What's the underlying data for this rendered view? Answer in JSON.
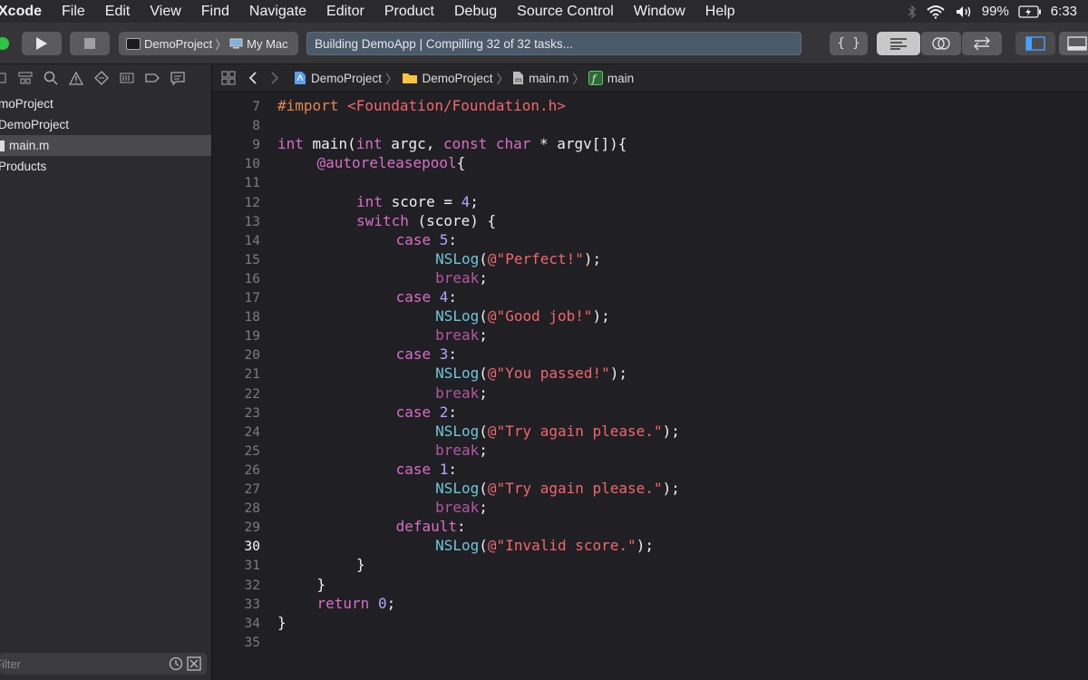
{
  "menubar": {
    "app": "Xcode",
    "items": [
      "File",
      "Edit",
      "View",
      "Find",
      "Navigate",
      "Editor",
      "Product",
      "Debug",
      "Source Control",
      "Window",
      "Help"
    ],
    "battery": "99%",
    "time": "6:33"
  },
  "toolbar": {
    "scheme": "DemoProject",
    "destination": "My Mac",
    "activity": "Building DemoApp | Compilling 32 of 32 tasks..."
  },
  "navigator": {
    "items": [
      {
        "label": "moProject",
        "indent": 0
      },
      {
        "label": "DemoProject",
        "indent": 0
      },
      {
        "label": "main.m",
        "indent": 1
      },
      {
        "label": "Products",
        "indent": 0
      }
    ],
    "filter_placeholder": "Filter"
  },
  "jumpbar": {
    "crumbs": [
      "DemoProject",
      "DemoProject",
      "main.m",
      "main"
    ]
  },
  "editor": {
    "current_line": 30,
    "lines": [
      {
        "n": "7",
        "indent": 0,
        "tokens": [
          [
            "pre",
            "#import "
          ],
          [
            "str",
            "<Foundation/Foundation.h>"
          ]
        ]
      },
      {
        "n": "8",
        "indent": 0,
        "tokens": []
      },
      {
        "n": "9",
        "indent": 0,
        "tokens": [
          [
            "kw",
            "int"
          ],
          [
            "pl",
            " main("
          ],
          [
            "kw",
            "int"
          ],
          [
            "pl",
            " argc, "
          ],
          [
            "kw",
            "const char"
          ],
          [
            "pl",
            " * argv[]){"
          ]
        ]
      },
      {
        "n": "10",
        "indent": 4,
        "tokens": [
          [
            "kw",
            "@autoreleasepool"
          ],
          [
            "pl",
            "{"
          ]
        ]
      },
      {
        "n": "11",
        "indent": 0,
        "tokens": []
      },
      {
        "n": "12",
        "indent": 8,
        "tokens": [
          [
            "kw",
            "int"
          ],
          [
            "pl",
            " score = "
          ],
          [
            "num",
            "4"
          ],
          [
            "pl",
            ";"
          ]
        ]
      },
      {
        "n": "13",
        "indent": 8,
        "tokens": [
          [
            "kw",
            "switch"
          ],
          [
            "pl",
            " (score) {"
          ]
        ]
      },
      {
        "n": "14",
        "indent": 12,
        "tokens": [
          [
            "kw",
            "case "
          ],
          [
            "num",
            "5"
          ],
          [
            "pl",
            ":"
          ]
        ]
      },
      {
        "n": "15",
        "indent": 16,
        "tokens": [
          [
            "fn",
            "NSLog"
          ],
          [
            "pl",
            "("
          ],
          [
            "str",
            "@\"Perfect!\""
          ],
          [
            "pl",
            ");"
          ]
        ]
      },
      {
        "n": "16",
        "indent": 16,
        "tokens": [
          [
            "brk",
            "break"
          ],
          [
            "pl",
            ";"
          ]
        ]
      },
      {
        "n": "17",
        "indent": 12,
        "tokens": [
          [
            "kw",
            "case "
          ],
          [
            "num",
            "4"
          ],
          [
            "pl",
            ":"
          ]
        ]
      },
      {
        "n": "18",
        "indent": 16,
        "tokens": [
          [
            "fn",
            "NSLog"
          ],
          [
            "pl",
            "("
          ],
          [
            "str",
            "@\"Good job!\""
          ],
          [
            "pl",
            ");"
          ]
        ]
      },
      {
        "n": "19",
        "indent": 16,
        "tokens": [
          [
            "brk",
            "break"
          ],
          [
            "pl",
            ";"
          ]
        ]
      },
      {
        "n": "20",
        "indent": 12,
        "tokens": [
          [
            "kw",
            "case "
          ],
          [
            "num",
            "3"
          ],
          [
            "pl",
            ":"
          ]
        ]
      },
      {
        "n": "21",
        "indent": 16,
        "tokens": [
          [
            "fn",
            "NSLog"
          ],
          [
            "pl",
            "("
          ],
          [
            "str",
            "@\"You passed!\""
          ],
          [
            "pl",
            ");"
          ]
        ]
      },
      {
        "n": "22",
        "indent": 16,
        "tokens": [
          [
            "brk",
            "break"
          ],
          [
            "pl",
            ";"
          ]
        ]
      },
      {
        "n": "23",
        "indent": 12,
        "tokens": [
          [
            "kw",
            "case "
          ],
          [
            "num",
            "2"
          ],
          [
            "pl",
            ":"
          ]
        ]
      },
      {
        "n": "24",
        "indent": 16,
        "tokens": [
          [
            "fn",
            "NSLog"
          ],
          [
            "pl",
            "("
          ],
          [
            "str",
            "@\"Try again please.\""
          ],
          [
            "pl",
            ");"
          ]
        ]
      },
      {
        "n": "25",
        "indent": 16,
        "tokens": [
          [
            "brk",
            "break"
          ],
          [
            "pl",
            ";"
          ]
        ]
      },
      {
        "n": "26",
        "indent": 12,
        "tokens": [
          [
            "kw",
            "case "
          ],
          [
            "num",
            "1"
          ],
          [
            "pl",
            ":"
          ]
        ]
      },
      {
        "n": "27",
        "indent": 16,
        "tokens": [
          [
            "fn",
            "NSLog"
          ],
          [
            "pl",
            "("
          ],
          [
            "str",
            "@\"Try again please.\""
          ],
          [
            "pl",
            ");"
          ]
        ]
      },
      {
        "n": "28",
        "indent": 16,
        "tokens": [
          [
            "brk",
            "break"
          ],
          [
            "pl",
            ";"
          ]
        ]
      },
      {
        "n": "29",
        "indent": 12,
        "tokens": [
          [
            "kw",
            "default"
          ],
          [
            "pl",
            ":"
          ]
        ]
      },
      {
        "n": "30",
        "indent": 16,
        "tokens": [
          [
            "fn",
            "NSLog"
          ],
          [
            "pl",
            "("
          ],
          [
            "str",
            "@\"Invalid score.\""
          ],
          [
            "pl",
            ");"
          ]
        ]
      },
      {
        "n": "31",
        "indent": 8,
        "tokens": [
          [
            "pl",
            "}"
          ]
        ]
      },
      {
        "n": "32",
        "indent": 4,
        "tokens": [
          [
            "pl",
            "}"
          ]
        ]
      },
      {
        "n": "33",
        "indent": 4,
        "tokens": [
          [
            "kw",
            "return"
          ],
          [
            "pl",
            " "
          ],
          [
            "num",
            "0"
          ],
          [
            "pl",
            ";"
          ]
        ]
      },
      {
        "n": "34",
        "indent": 0,
        "tokens": [
          [
            "pl",
            "}"
          ]
        ]
      },
      {
        "n": "35",
        "indent": 0,
        "tokens": []
      }
    ]
  }
}
